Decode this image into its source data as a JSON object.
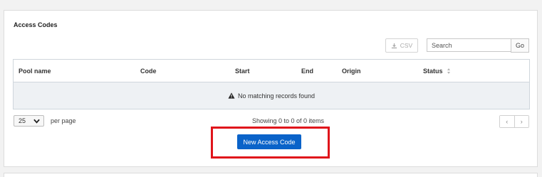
{
  "panel": {
    "title": "Access Codes"
  },
  "toolbar": {
    "csv_label": "CSV",
    "csv_icon": "download-icon",
    "search_placeholder": "Search",
    "search_value": "",
    "go_label": "Go"
  },
  "table": {
    "columns": [
      "Pool name",
      "Code",
      "Start",
      "End",
      "Origin",
      "Status"
    ],
    "sortable_column": "Status",
    "empty_message": "No matching records found",
    "empty_icon": "warning-icon"
  },
  "footer": {
    "per_page_value": "25",
    "per_page_label": "per page",
    "showing_text": "Showing 0 to 0 of 0 items",
    "prev_label": "‹",
    "next_label": "›"
  },
  "actions": {
    "new_button_label": "New Access Code"
  },
  "colors": {
    "primary": "#0a63c9",
    "highlight": "#e0141b",
    "empty_row_bg": "#eef1f4"
  }
}
